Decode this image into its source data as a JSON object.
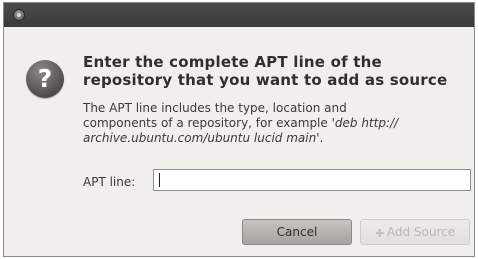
{
  "window": {
    "title_icon": "close-icon"
  },
  "dialog": {
    "icon": "question-icon",
    "icon_glyph": "?",
    "headline_line1": "Enter the complete APT line of the",
    "headline_line2": "repository that you want to add as source",
    "description_line1": "The APT line includes the type, location and",
    "description_line2_text": "components of a repository, for example  ",
    "description_example_part1": "'deb http://",
    "description_example_part2": "archive.ubuntu.com/ubuntu lucid main",
    "description_end": "'.",
    "field_label": "APT line:",
    "field_value": ""
  },
  "buttons": {
    "cancel_label": "Cancel",
    "add_label": "Add Source",
    "add_enabled": false
  }
}
